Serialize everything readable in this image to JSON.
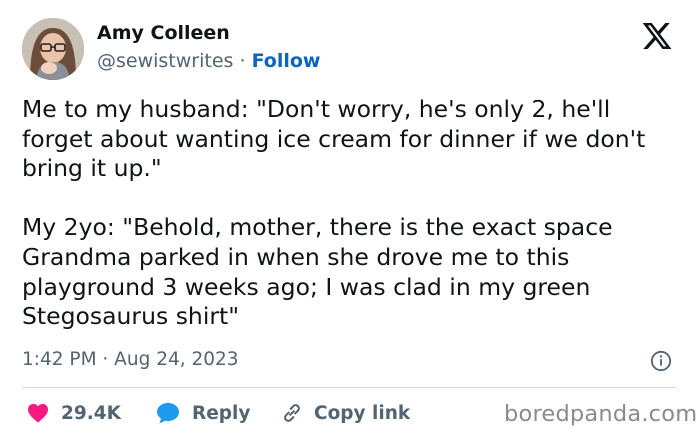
{
  "author": {
    "name": "Amy Colleen",
    "handle": "@sewistwrites",
    "separator": " · ",
    "follow_label": "Follow"
  },
  "tweet": {
    "paragraphs": [
      "Me to my husband: \"Don't worry, he's only 2, he'll forget about wanting ice cream for dinner if we don't bring it up.\"",
      "My 2yo: \"Behold, mother, there is the exact space Grandma parked in when she drove me to this playground 3 weeks ago; I was clad in my green Stegosaurus shirt\""
    ],
    "timestamp": "1:42 PM · Aug 24, 2023"
  },
  "actions": {
    "likes": "29.4K",
    "reply_label": "Reply",
    "copy_label": "Copy link"
  },
  "watermark": "boredpanda.com",
  "colors": {
    "text": "#0f1419",
    "secondary": "#536471",
    "follow": "#0a66c2",
    "heart": "#f91880",
    "reply_icon": "#1d9bf0",
    "divider": "#cfd9de"
  },
  "icons": [
    "x-logo-icon",
    "info-icon",
    "heart-icon",
    "reply-bubble-icon",
    "link-icon"
  ]
}
